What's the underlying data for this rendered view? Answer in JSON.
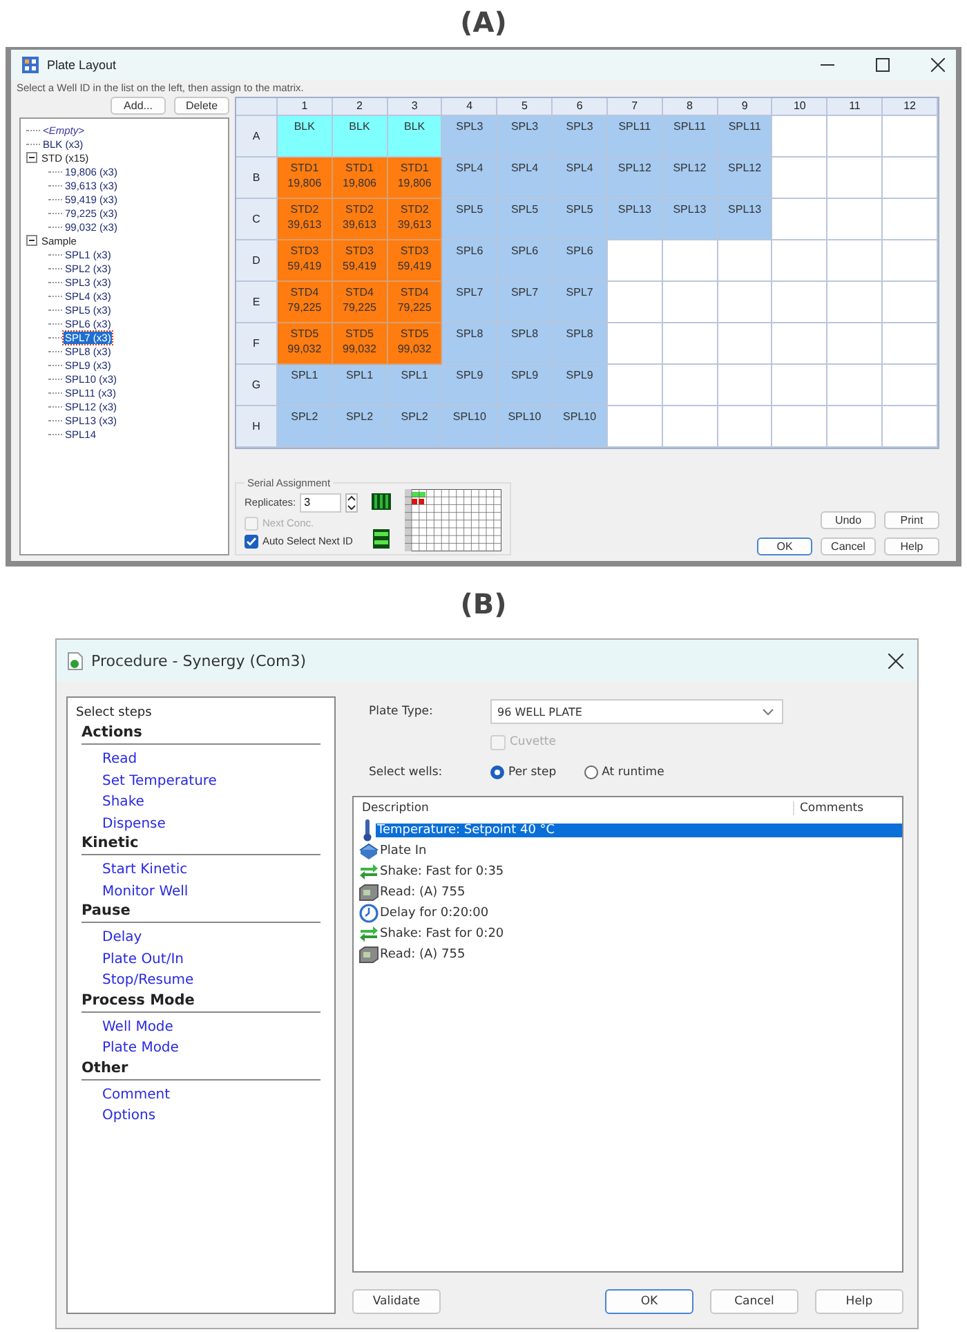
{
  "panel_a": {
    "label": "(A)",
    "window": {
      "title": "Plate Layout"
    },
    "instruction": "Select a Well ID in the list on the left, then assign to the matrix.",
    "list_buttons": [
      "Add...",
      "Delete"
    ],
    "tree": [
      {
        "label": "<Empty>",
        "kind": "none",
        "selected": false
      },
      {
        "label": "BLK (x3)",
        "kind": "id",
        "selected": false
      },
      {
        "label": "STD (x15)",
        "kind": "group",
        "selected": false,
        "expanded": true,
        "children": [
          {
            "label": "19,806 (x3)",
            "kind": "id",
            "selected": false
          },
          {
            "label": "39,613 (x3)",
            "kind": "id",
            "selected": false
          },
          {
            "label": "59,419 (x3)",
            "kind": "id",
            "selected": false
          },
          {
            "label": "79,225 (x3)",
            "kind": "id",
            "selected": false
          },
          {
            "label": "99,032 (x3)",
            "kind": "id",
            "selected": false
          }
        ]
      },
      {
        "label": "Sample",
        "kind": "group",
        "selected": false,
        "expanded": true,
        "children": [
          {
            "label": "SPL1 (x3)",
            "kind": "id",
            "selected": false
          },
          {
            "label": "SPL2 (x3)",
            "kind": "id",
            "selected": false
          },
          {
            "label": "SPL3 (x3)",
            "kind": "id",
            "selected": false
          },
          {
            "label": "SPL4 (x3)",
            "kind": "id",
            "selected": false
          },
          {
            "label": "SPL5 (x3)",
            "kind": "id",
            "selected": false
          },
          {
            "label": "SPL6 (x3)",
            "kind": "id",
            "selected": false
          },
          {
            "label": "SPL7 (x3)",
            "kind": "id",
            "selected": true
          },
          {
            "label": "SPL8 (x3)",
            "kind": "id",
            "selected": false
          },
          {
            "label": "SPL9 (x3)",
            "kind": "id",
            "selected": false
          },
          {
            "label": "SPL10 (x3)",
            "kind": "id",
            "selected": false
          },
          {
            "label": "SPL11 (x3)",
            "kind": "id",
            "selected": false
          },
          {
            "label": "SPL12 (x3)",
            "kind": "id",
            "selected": false
          },
          {
            "label": "SPL13 (x3)",
            "kind": "id",
            "selected": false
          },
          {
            "label": "SPL14",
            "kind": "id",
            "selected": false
          }
        ]
      }
    ],
    "plate": {
      "columns": [
        "1",
        "2",
        "3",
        "4",
        "5",
        "6",
        "7",
        "8",
        "9",
        "10",
        "11",
        "12"
      ],
      "rows": [
        {
          "label": "A",
          "cells": [
            {
              "kind": "blank",
              "lines": [
                "BLK"
              ]
            },
            {
              "kind": "blank",
              "lines": [
                "BLK"
              ]
            },
            {
              "kind": "blank",
              "lines": [
                "BLK"
              ]
            },
            {
              "kind": "sample",
              "lines": [
                "SPL3"
              ]
            },
            {
              "kind": "sample",
              "lines": [
                "SPL3"
              ]
            },
            {
              "kind": "sample",
              "lines": [
                "SPL3"
              ]
            },
            {
              "kind": "sample",
              "lines": [
                "SPL11"
              ]
            },
            {
              "kind": "sample",
              "lines": [
                "SPL11"
              ]
            },
            {
              "kind": "sample",
              "lines": [
                "SPL11"
              ]
            },
            {
              "kind": "empty"
            },
            {
              "kind": "empty"
            },
            {
              "kind": "empty"
            }
          ]
        },
        {
          "label": "B",
          "cells": [
            {
              "kind": "standard",
              "lines": [
                "STD1",
                "19,806"
              ]
            },
            {
              "kind": "standard",
              "lines": [
                "STD1",
                "19,806"
              ]
            },
            {
              "kind": "standard",
              "lines": [
                "STD1",
                "19,806"
              ]
            },
            {
              "kind": "sample",
              "lines": [
                "SPL4"
              ]
            },
            {
              "kind": "sample",
              "lines": [
                "SPL4"
              ]
            },
            {
              "kind": "sample",
              "lines": [
                "SPL4"
              ]
            },
            {
              "kind": "sample",
              "lines": [
                "SPL12"
              ]
            },
            {
              "kind": "sample",
              "lines": [
                "SPL12"
              ]
            },
            {
              "kind": "sample",
              "lines": [
                "SPL12"
              ]
            },
            {
              "kind": "empty"
            },
            {
              "kind": "empty"
            },
            {
              "kind": "empty"
            }
          ]
        },
        {
          "label": "C",
          "cells": [
            {
              "kind": "standard",
              "lines": [
                "STD2",
                "39,613"
              ]
            },
            {
              "kind": "standard",
              "lines": [
                "STD2",
                "39,613"
              ]
            },
            {
              "kind": "standard",
              "lines": [
                "STD2",
                "39,613"
              ]
            },
            {
              "kind": "sample",
              "lines": [
                "SPL5"
              ]
            },
            {
              "kind": "sample",
              "lines": [
                "SPL5"
              ]
            },
            {
              "kind": "sample",
              "lines": [
                "SPL5"
              ]
            },
            {
              "kind": "sample",
              "lines": [
                "SPL13"
              ]
            },
            {
              "kind": "sample",
              "lines": [
                "SPL13"
              ]
            },
            {
              "kind": "sample",
              "lines": [
                "SPL13"
              ]
            },
            {
              "kind": "empty"
            },
            {
              "kind": "empty"
            },
            {
              "kind": "empty"
            }
          ]
        },
        {
          "label": "D",
          "cells": [
            {
              "kind": "standard",
              "lines": [
                "STD3",
                "59,419"
              ]
            },
            {
              "kind": "standard",
              "lines": [
                "STD3",
                "59,419"
              ]
            },
            {
              "kind": "standard",
              "lines": [
                "STD3",
                "59,419"
              ]
            },
            {
              "kind": "sample",
              "lines": [
                "SPL6"
              ]
            },
            {
              "kind": "sample",
              "lines": [
                "SPL6"
              ]
            },
            {
              "kind": "sample",
              "lines": [
                "SPL6"
              ]
            },
            {
              "kind": "empty"
            },
            {
              "kind": "empty"
            },
            {
              "kind": "empty"
            },
            {
              "kind": "empty"
            },
            {
              "kind": "empty"
            },
            {
              "kind": "empty"
            }
          ]
        },
        {
          "label": "E",
          "cells": [
            {
              "kind": "standard",
              "lines": [
                "STD4",
                "79,225"
              ]
            },
            {
              "kind": "standard",
              "lines": [
                "STD4",
                "79,225"
              ]
            },
            {
              "kind": "standard",
              "lines": [
                "STD4",
                "79,225"
              ]
            },
            {
              "kind": "sample",
              "lines": [
                "SPL7"
              ]
            },
            {
              "kind": "sample",
              "lines": [
                "SPL7"
              ]
            },
            {
              "kind": "sample",
              "lines": [
                "SPL7"
              ]
            },
            {
              "kind": "empty"
            },
            {
              "kind": "empty"
            },
            {
              "kind": "empty"
            },
            {
              "kind": "empty"
            },
            {
              "kind": "empty"
            },
            {
              "kind": "empty"
            }
          ]
        },
        {
          "label": "F",
          "cells": [
            {
              "kind": "standard",
              "lines": [
                "STD5",
                "99,032"
              ]
            },
            {
              "kind": "standard",
              "lines": [
                "STD5",
                "99,032"
              ]
            },
            {
              "kind": "standard",
              "lines": [
                "STD5",
                "99,032"
              ]
            },
            {
              "kind": "sample",
              "lines": [
                "SPL8"
              ]
            },
            {
              "kind": "sample",
              "lines": [
                "SPL8"
              ]
            },
            {
              "kind": "sample",
              "lines": [
                "SPL8"
              ]
            },
            {
              "kind": "empty"
            },
            {
              "kind": "empty"
            },
            {
              "kind": "empty"
            },
            {
              "kind": "empty"
            },
            {
              "kind": "empty"
            },
            {
              "kind": "empty"
            }
          ]
        },
        {
          "label": "G",
          "cells": [
            {
              "kind": "sample",
              "lines": [
                "SPL1"
              ]
            },
            {
              "kind": "sample",
              "lines": [
                "SPL1"
              ]
            },
            {
              "kind": "sample",
              "lines": [
                "SPL1"
              ]
            },
            {
              "kind": "sample",
              "lines": [
                "SPL9"
              ]
            },
            {
              "kind": "sample",
              "lines": [
                "SPL9"
              ]
            },
            {
              "kind": "sample",
              "lines": [
                "SPL9"
              ]
            },
            {
              "kind": "empty"
            },
            {
              "kind": "empty"
            },
            {
              "kind": "empty"
            },
            {
              "kind": "empty"
            },
            {
              "kind": "empty"
            },
            {
              "kind": "empty"
            }
          ]
        },
        {
          "label": "H",
          "cells": [
            {
              "kind": "sample",
              "lines": [
                "SPL2"
              ]
            },
            {
              "kind": "sample",
              "lines": [
                "SPL2"
              ]
            },
            {
              "kind": "sample",
              "lines": [
                "SPL2"
              ]
            },
            {
              "kind": "sample",
              "lines": [
                "SPL10"
              ]
            },
            {
              "kind": "sample",
              "lines": [
                "SPL10"
              ]
            },
            {
              "kind": "sample",
              "lines": [
                "SPL10"
              ]
            },
            {
              "kind": "empty"
            },
            {
              "kind": "empty"
            },
            {
              "kind": "empty"
            },
            {
              "kind": "empty"
            },
            {
              "kind": "empty"
            },
            {
              "kind": "empty"
            }
          ]
        }
      ]
    },
    "serial": {
      "title": "Serial Assignment",
      "replicates_label": "Replicates:",
      "replicates": "3",
      "checkboxes": [
        {
          "label": "Next Conc.",
          "checked": false,
          "disabled": true
        },
        {
          "label": "Auto Select Next ID",
          "checked": true,
          "disabled": false
        }
      ]
    },
    "buttons": [
      {
        "label": "Undo",
        "default": false
      },
      {
        "label": "Print",
        "default": false
      },
      {
        "label": "OK",
        "default": true
      },
      {
        "label": "Cancel",
        "default": false
      },
      {
        "label": "Help",
        "default": false
      }
    ]
  },
  "panel_b": {
    "label": "(B)",
    "window": {
      "title": "Procedure - Synergy (Com3)"
    },
    "steps_title": "Select steps",
    "sections": [
      {
        "heading": "Actions",
        "items": [
          "Read",
          "Set Temperature",
          "Shake",
          "Dispense"
        ]
      },
      {
        "heading": "Kinetic",
        "items": [
          "Start Kinetic",
          "Monitor Well"
        ]
      },
      {
        "heading": "Pause",
        "items": [
          "Delay",
          "Plate Out/In",
          "Stop/Resume"
        ]
      },
      {
        "heading": "Process Mode",
        "items": [
          "Well Mode",
          "Plate Mode"
        ]
      },
      {
        "heading": "Other",
        "items": [
          "Comment",
          "Options"
        ]
      }
    ],
    "plate_type": {
      "label": "Plate Type:",
      "value": "96 WELL PLATE"
    },
    "cuvette": {
      "label": "Cuvette",
      "checked": false,
      "disabled": true
    },
    "select_wells": {
      "label": "Select wells:",
      "options": [
        {
          "label": "Per step",
          "selected": true
        },
        {
          "label": "At runtime",
          "selected": false
        }
      ]
    },
    "table": {
      "columns": [
        "Description",
        "Comments"
      ],
      "rows": [
        {
          "kind": "temperature",
          "text": "Temperature:  Setpoint 40 °C",
          "selected": true
        },
        {
          "kind": "plate",
          "text": "Plate In",
          "selected": false
        },
        {
          "kind": "shake",
          "text": "Shake: Fast for 0:35",
          "selected": false
        },
        {
          "kind": "read",
          "text": "Read:  (A) 755",
          "selected": false
        },
        {
          "kind": "delay",
          "text": "Delay for 0:20:00",
          "selected": false
        },
        {
          "kind": "shake",
          "text": "Shake: Fast for 0:20",
          "selected": false
        },
        {
          "kind": "read",
          "text": "Read:  (A) 755",
          "selected": false
        }
      ]
    },
    "buttons": [
      {
        "label": "Validate",
        "default": false
      },
      {
        "label": "OK",
        "default": true
      },
      {
        "label": "Cancel",
        "default": false
      },
      {
        "label": "Help",
        "default": false
      }
    ]
  }
}
